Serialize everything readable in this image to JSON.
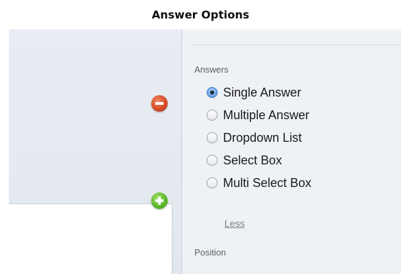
{
  "caption": "Answer Options",
  "answers_section": {
    "label": "Answers",
    "options": [
      {
        "label": "Single Answer",
        "selected": true
      },
      {
        "label": "Multiple Answer",
        "selected": false
      },
      {
        "label": "Dropdown List",
        "selected": false
      },
      {
        "label": "Select Box",
        "selected": false
      },
      {
        "label": "Multi Select Box",
        "selected": false
      }
    ],
    "less_link": "Less"
  },
  "position_section": {
    "label": "Position"
  },
  "icons": {
    "remove": "minus-circle-icon",
    "add": "plus-circle-icon"
  },
  "colors": {
    "remove_red": "#d94a26",
    "add_green": "#5cb82c",
    "radio_selected_blue": "#6ea6e6"
  }
}
